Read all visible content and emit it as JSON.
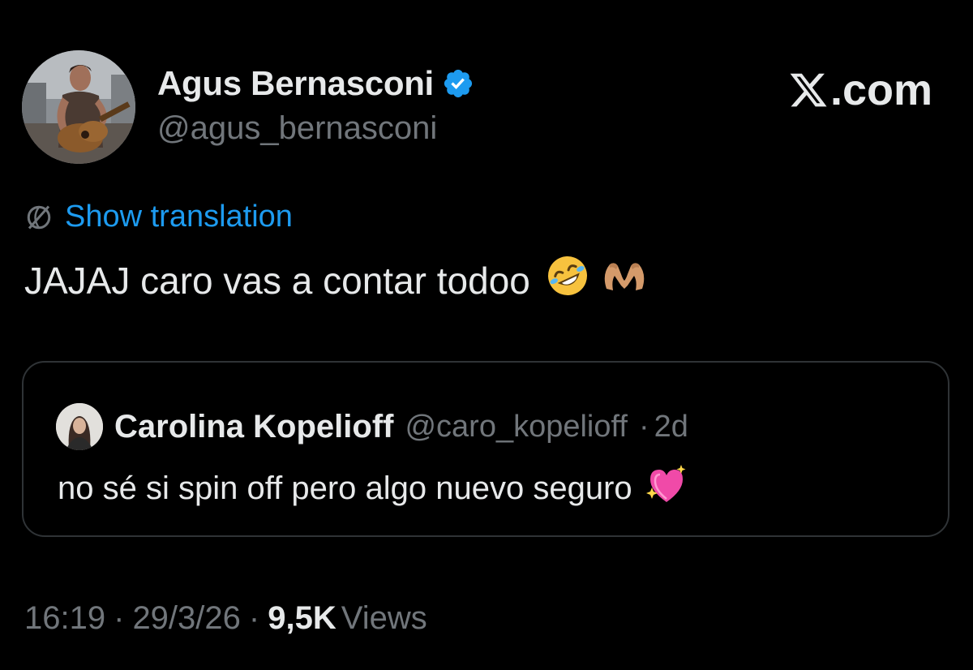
{
  "author": {
    "display_name": "Agus Bernasconi",
    "handle": "@agus_bernasconi",
    "verified": true,
    "avatar_icon": "profile-photo-guitarist"
  },
  "brand": {
    "logo_icon": "x-logo-icon",
    "text": ".com"
  },
  "translation": {
    "icon": "globe-icon",
    "label": "Show translation"
  },
  "tweet": {
    "text": "JAJAJ caro vas a contar todoo",
    "emojis": [
      "rolling-on-floor-laughing-emoji",
      "heart-hands-emoji"
    ]
  },
  "quote": {
    "display_name": "Carolina Kopelioff",
    "handle": "@caro_kopelioff",
    "separator": "·",
    "time": "2d",
    "text": "no sé si spin off pero algo nuevo seguro",
    "emoji": "sparkling-heart-emoji",
    "avatar_icon": "profile-photo-woman"
  },
  "meta": {
    "time": "16:19",
    "sep1": "·",
    "date": "29/3/26",
    "sep2": "·",
    "views_count": "9,5K",
    "views_label": "Views"
  },
  "colors": {
    "background": "#000000",
    "text_primary": "#e7e9ea",
    "text_secondary": "#71767b",
    "link": "#1d9bf0",
    "border": "#2f3336",
    "verified": "#1d9bf0"
  }
}
